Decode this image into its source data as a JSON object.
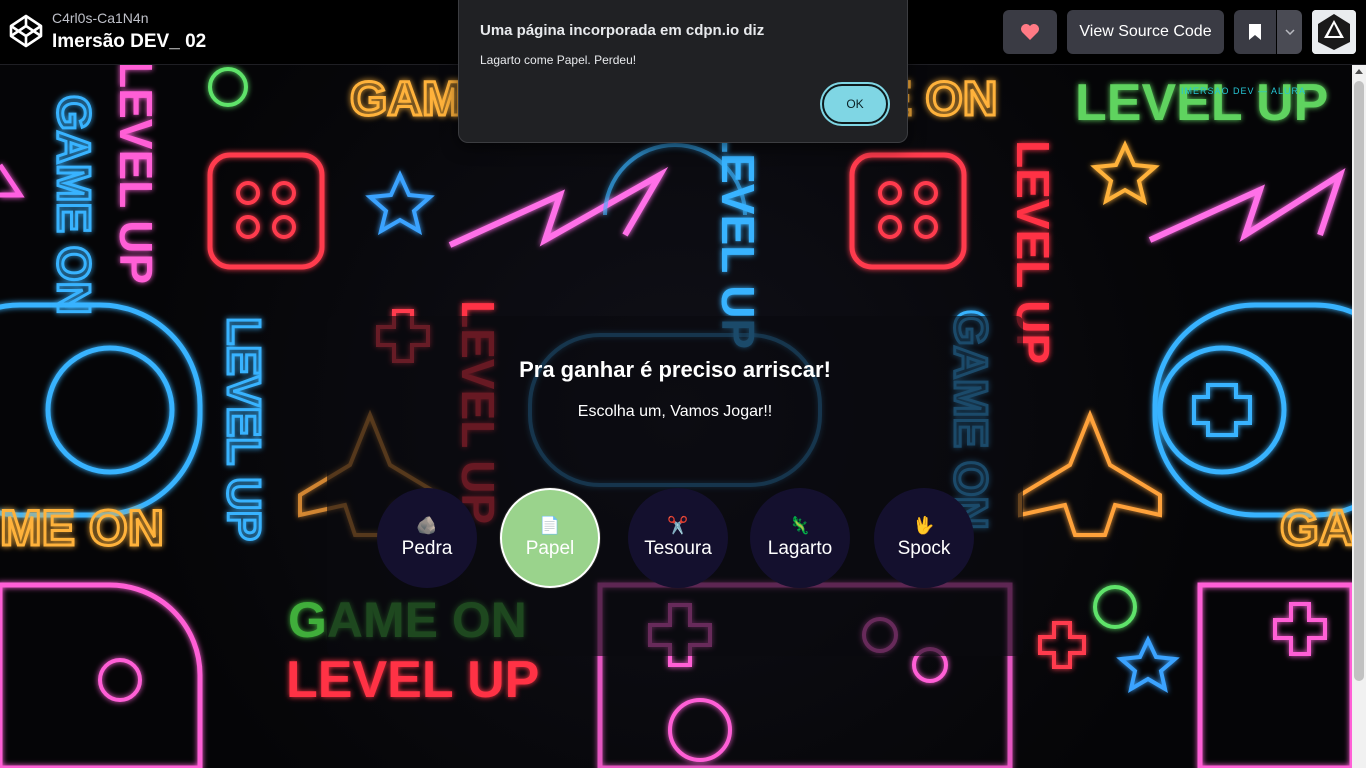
{
  "header": {
    "author": "C4rl0s-Ca1N4n",
    "pen_title": "Imersão DEV_ 02",
    "view_source_label": "View Source Code",
    "icons": [
      "codepen-logo-icon",
      "heart-icon",
      "bookmark-icon",
      "chevron-down-icon",
      "avatar"
    ]
  },
  "background": {
    "words": [
      "GAME ON",
      "LEVEL UP"
    ],
    "credit": "IMERSAO DEV — ALURA"
  },
  "game": {
    "title": "Pra ganhar é preciso arriscar!",
    "subtitle": "Escolha um, Vamos Jogar!!",
    "choices": [
      {
        "label": "Pedra",
        "icon": "🪨"
      },
      {
        "label": "Papel",
        "icon": "📄"
      },
      {
        "label": "Tesoura",
        "icon": "✂️"
      },
      {
        "label": "Lagarto",
        "icon": "🦎"
      },
      {
        "label": "Spock",
        "icon": "🖖"
      }
    ],
    "selected": "Papel",
    "selected_color": "#9ad38c"
  },
  "dialog": {
    "title": "Uma página incorporada em cdpn.io diz",
    "message": "Lagarto come Papel. Perdeu!",
    "ok_label": "OK",
    "accent": "#7fd6e4"
  }
}
